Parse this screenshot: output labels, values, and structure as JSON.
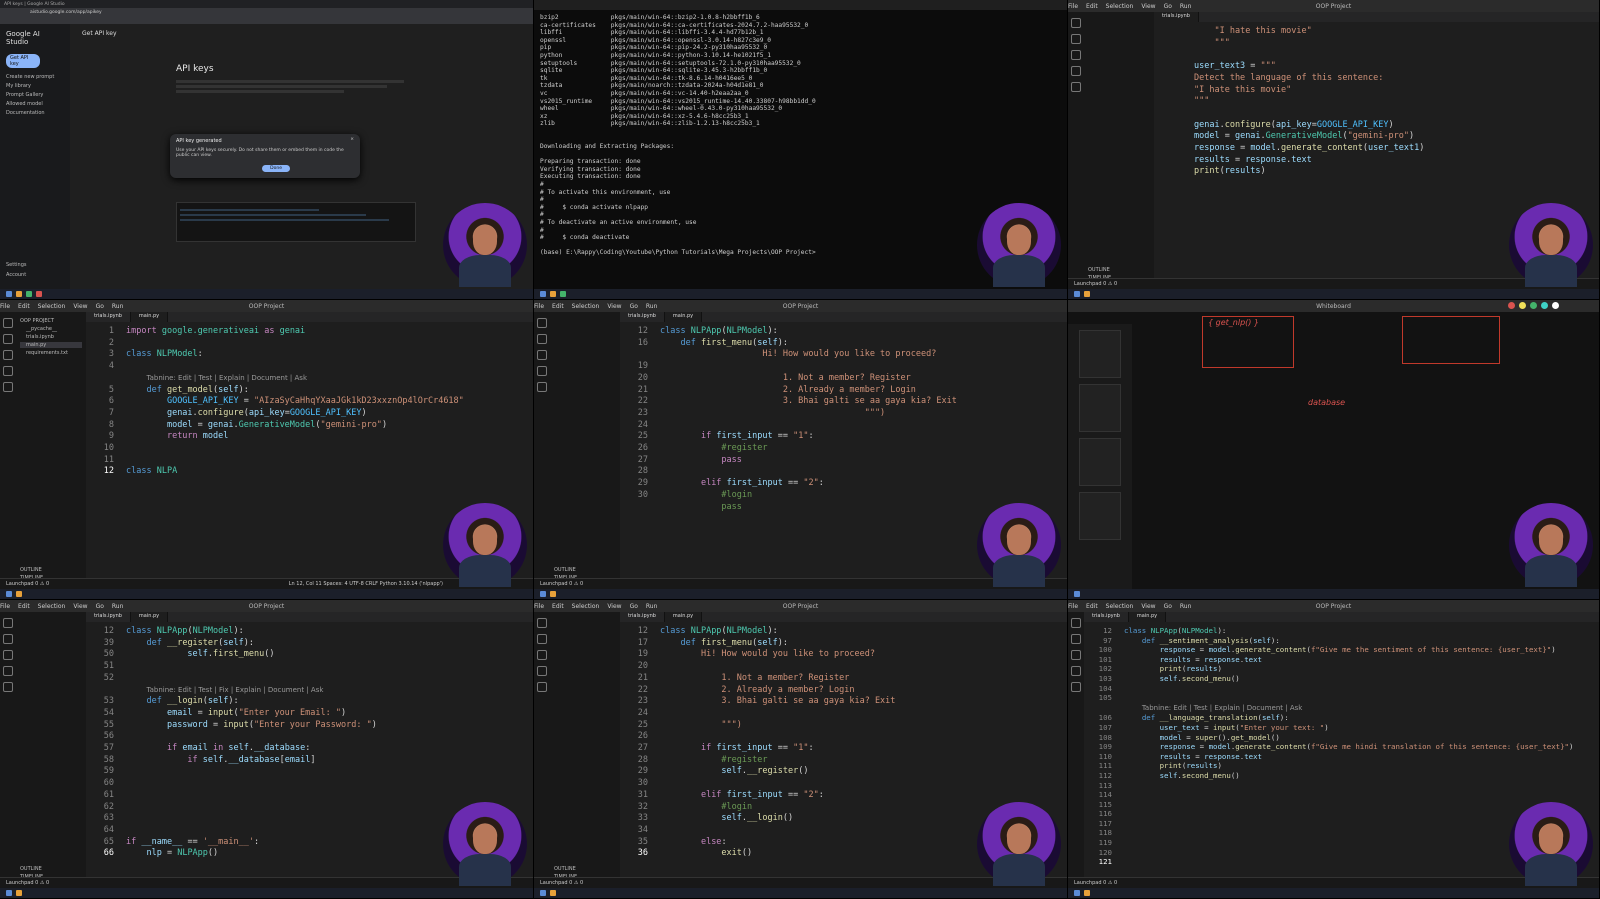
{
  "panel1": {
    "browser": {
      "tab_title": "API keys | Google AI Studio",
      "address": "aistudio.google.com/app/apikey"
    },
    "ai_studio": {
      "brand": "Google AI Studio",
      "header": "Get API key",
      "get_api_key_button": "Get API key",
      "nav_items": [
        "Create new prompt",
        "My library",
        "Prompt Gallery",
        "Allowed model",
        "Documentation"
      ],
      "footer_items": [
        "Settings",
        "Account"
      ],
      "page_title": "API keys",
      "dialog_title": "API key generated",
      "dialog_text": "Use your API keys securely. Do not share them or embed them in code the public can view.",
      "dialog_done": "Done"
    }
  },
  "panel2": {
    "terminal_lines": [
      "bzip2              pkgs/main/win-64::bzip2-1.0.8-h2bbff1b_6",
      "ca-certificates    pkgs/main/win-64::ca-certificates-2024.7.2-haa95532_0",
      "libffi             pkgs/main/win-64::libffi-3.4.4-hd77b12b_1",
      "openssl            pkgs/main/win-64::openssl-3.0.14-h827c3e9_0",
      "pip                pkgs/main/win-64::pip-24.2-py310haa95532_0",
      "python             pkgs/main/win-64::python-3.10.14-he1021f5_1",
      "setuptools         pkgs/main/win-64::setuptools-72.1.0-py310haa95532_0",
      "sqlite             pkgs/main/win-64::sqlite-3.45.3-h2bbff1b_0",
      "tk                 pkgs/main/win-64::tk-8.6.14-h0416ee5_0",
      "tzdata             pkgs/main/noarch::tzdata-2024a-h04d1e81_0",
      "vc                 pkgs/main/win-64::vc-14.40-h2eaa2aa_0",
      "vs2015_runtime     pkgs/main/win-64::vs2015_runtime-14.40.33807-h98bb1dd_0",
      "wheel              pkgs/main/win-64::wheel-0.43.0-py310haa95532_0",
      "xz                 pkgs/main/win-64::xz-5.4.6-h8cc25b3_1",
      "zlib               pkgs/main/win-64::zlib-1.2.13-h8cc25b3_1",
      "",
      "",
      "Downloading and Extracting Packages:",
      "",
      "Preparing transaction: done",
      "Verifying transaction: done",
      "Executing transaction: done",
      "#",
      "# To activate this environment, use",
      "#",
      "#     $ conda activate nlpapp",
      "#",
      "# To deactivate an active environment, use",
      "#",
      "#     $ conda deactivate",
      "",
      "(base) E:\\Rappy\\Coding\\Youtube\\Python Tutorials\\Mega Projects\\OOP Project>"
    ]
  },
  "panel3": {
    "title": "OOP Project",
    "tabs": [
      "trials.ipynb"
    ],
    "code_lines": [
      {
        "n": "",
        "html": "    <span class='str'>\"I hate this movie\"</span>"
      },
      {
        "n": "",
        "html": "    <span class='str'>\"\"\"</span>"
      },
      {
        "n": "",
        "html": ""
      },
      {
        "n": "",
        "html": "<span class='var'>user_text3</span> = <span class='str'>\"\"\"</span>"
      },
      {
        "n": "",
        "html": "<span class='str'>Detect the language of this sentence:</span>"
      },
      {
        "n": "",
        "html": "<span class='str'>\"I hate this movie\"</span>"
      },
      {
        "n": "",
        "html": "<span class='str'>\"\"\"</span>"
      },
      {
        "n": "",
        "html": ""
      },
      {
        "n": "",
        "html": "<span class='var'>genai</span>.<span class='fn'>configure</span>(<span class='var'>api_key</span>=<span class='const'>GOOGLE_API_KEY</span>)"
      },
      {
        "n": "",
        "html": "<span class='var'>model</span> = <span class='var'>genai</span>.<span class='cls'>GenerativeModel</span>(<span class='str'>\"gemini-pro\"</span>)"
      },
      {
        "n": "",
        "html": "<span class='var'>response</span> = <span class='var'>model</span>.<span class='fn'>generate_content</span>(<span class='var'>user_text1</span>)"
      },
      {
        "n": "",
        "html": "<span class='var'>results</span> = <span class='var'>response</span>.<span class='var'>text</span>"
      },
      {
        "n": "",
        "html": "<span class='fn'>print</span>(<span class='var'>results</span>)"
      }
    ]
  },
  "panel4": {
    "title": "OOP Project",
    "tabs": [
      "trials.ipynb",
      "main.py"
    ],
    "explorer": [
      "OOP PROJECT",
      "__pycache__",
      "trials.ipynb",
      "main.py",
      "requirements.txt"
    ],
    "code_lines": [
      {
        "n": "1",
        "html": "<span class='kw'>import</span> <span class='cls'>google.generativeai</span> <span class='kw'>as</span> <span class='cls'>genai</span>"
      },
      {
        "n": "2",
        "html": ""
      },
      {
        "n": "3",
        "html": "<span class='kwb'>class</span> <span class='cls'>NLPModel</span>:"
      },
      {
        "n": "4",
        "html": ""
      },
      {
        "n": "",
        "html": "    <span class='hint'>Tabnine: Edit | Test | Explain | Document | Ask</span>"
      },
      {
        "n": "5",
        "html": "    <span class='kwb'>def</span> <span class='fn'>get_model</span>(<span class='var'>self</span>):"
      },
      {
        "n": "6",
        "html": "        <span class='const'>GOOGLE_API_KEY</span> = <span class='str'>\"AIzaSyCaHhqYXaaJGk1kD23xxznOp4lOrCr4618\"</span>"
      },
      {
        "n": "7",
        "html": "        <span class='var'>genai</span>.<span class='fn'>configure</span>(<span class='var'>api_key</span>=<span class='const'>GOOGLE_API_KEY</span>)"
      },
      {
        "n": "8",
        "html": "        <span class='var'>model</span> = <span class='var'>genai</span>.<span class='cls'>GenerativeModel</span>(<span class='str'>\"gemini-pro\"</span>)"
      },
      {
        "n": "9",
        "html": "        <span class='kw'>return</span> <span class='var'>model</span>"
      },
      {
        "n": "10",
        "html": ""
      },
      {
        "n": "11",
        "html": ""
      },
      {
        "n": "12",
        "html": "<span class='kwb'>class</span> <span class='cls'>NLPA</span>"
      }
    ],
    "status": "Ln 12, Col 11   Spaces: 4   UTF-8   CRLF   Python   3.10.14 ('nlpapp')"
  },
  "panel5": {
    "title": "OOP Project",
    "tabs": [
      "trials.ipynb",
      "main.py"
    ],
    "code_lines": [
      {
        "n": "12",
        "html": "<span class='kwb'>class</span> <span class='cls'>NLPApp</span>(<span class='cls'>NLPModel</span>):"
      },
      {
        "n": "16",
        "html": "    <span class='kwb'>def</span> <span class='fn'>first_menu</span>(<span class='var'>self</span>):"
      },
      {
        "n": "",
        "html": "                    <span class='str'>Hi! How would you like to proceed?</span>"
      },
      {
        "n": "19",
        "html": ""
      },
      {
        "n": "20",
        "html": "                        <span class='str'>1. Not a member? Register</span>"
      },
      {
        "n": "21",
        "html": "                        <span class='str'>2. Already a member? Login</span>"
      },
      {
        "n": "22",
        "html": "                        <span class='str'>3. Bhai galti se aa gaya kia? Exit</span>"
      },
      {
        "n": "23",
        "html": "                                        <span class='str'>\"\"\")</span>"
      },
      {
        "n": "24",
        "html": ""
      },
      {
        "n": "25",
        "html": "        <span class='kw'>if</span> <span class='var'>first_input</span> == <span class='str'>\"1\"</span>:"
      },
      {
        "n": "26",
        "html": "            <span class='cm'>#register</span>"
      },
      {
        "n": "27",
        "html": "            <span class='kw'>pass</span>"
      },
      {
        "n": "28",
        "html": ""
      },
      {
        "n": "29",
        "html": "        <span class='kw'>elif</span> <span class='var'>first_input</span> == <span class='str'>\"2\"</span>:"
      },
      {
        "n": "30",
        "html": "            <span class='cm'>#login</span>"
      },
      {
        "n": "",
        "html": "            <span class='cm'>pass</span>"
      }
    ]
  },
  "panel6": {
    "toolbar_title": "Whiteboard",
    "annotations": [
      "{ get_nlp() }",
      "database"
    ]
  },
  "panel7": {
    "title": "OOP Project",
    "tabs": [
      "trials.ipynb",
      "main.py"
    ],
    "code_lines": [
      {
        "n": "12",
        "html": "<span class='kwb'>class</span> <span class='cls'>NLPApp</span>(<span class='cls'>NLPModel</span>):"
      },
      {
        "n": "39",
        "html": "    <span class='kwb'>def</span> <span class='fn'>__register</span>(<span class='var'>self</span>):"
      },
      {
        "n": "50",
        "html": "            <span class='var'>self</span>.<span class='fn'>first_menu</span>()"
      },
      {
        "n": "51",
        "html": ""
      },
      {
        "n": "52",
        "html": ""
      },
      {
        "n": "",
        "html": "    <span class='hint'>Tabnine: Edit | Test | Fix | Explain | Document | Ask</span>"
      },
      {
        "n": "53",
        "html": "    <span class='kwb'>def</span> <span class='fn'>__login</span>(<span class='var'>self</span>):"
      },
      {
        "n": "54",
        "html": "        <span class='var'>email</span> = <span class='fn'>input</span>(<span class='str'>\"Enter your Email: \"</span>)"
      },
      {
        "n": "55",
        "html": "        <span class='var'>password</span> = <span class='fn'>input</span>(<span class='str'>\"Enter your Password: \"</span>)"
      },
      {
        "n": "56",
        "html": ""
      },
      {
        "n": "57",
        "html": "        <span class='kw'>if</span> <span class='var'>email</span> <span class='kw'>in</span> <span class='var'>self</span>.<span class='var'>__database</span>:"
      },
      {
        "n": "58",
        "html": "            <span class='kw'>if</span> <span class='var'>self</span>.<span class='var'>__database</span>[<span class='var'>email</span>]"
      },
      {
        "n": "59",
        "html": ""
      },
      {
        "n": "60",
        "html": ""
      },
      {
        "n": "61",
        "html": ""
      },
      {
        "n": "62",
        "html": ""
      },
      {
        "n": "63",
        "html": ""
      },
      {
        "n": "64",
        "html": ""
      },
      {
        "n": "65",
        "html": "<span class='kw'>if</span> <span class='var'>__name__</span> == <span class='str'>'__main__'</span>:"
      },
      {
        "n": "66",
        "html": "    <span class='var'>nlp</span> = <span class='cls'>NLPApp</span>()"
      }
    ]
  },
  "panel8": {
    "title": "OOP Project",
    "tabs": [
      "trials.ipynb",
      "main.py"
    ],
    "code_lines": [
      {
        "n": "12",
        "html": "<span class='kwb'>class</span> <span class='cls'>NLPApp</span>(<span class='cls'>NLPModel</span>):"
      },
      {
        "n": "17",
        "html": "    <span class='kwb'>def</span> <span class='fn'>first_menu</span>(<span class='var'>self</span>):"
      },
      {
        "n": "19",
        "html": "        <span class='str'>Hi! How would you like to proceed?</span>"
      },
      {
        "n": "20",
        "html": ""
      },
      {
        "n": "21",
        "html": "            <span class='str'>1. Not a member? Register</span>"
      },
      {
        "n": "22",
        "html": "            <span class='str'>2. Already a member? Login</span>"
      },
      {
        "n": "23",
        "html": "            <span class='str'>3. Bhai galti se aa gaya kia? Exit</span>"
      },
      {
        "n": "24",
        "html": ""
      },
      {
        "n": "25",
        "html": "            <span class='str'>\"\"\")</span>"
      },
      {
        "n": "26",
        "html": ""
      },
      {
        "n": "27",
        "html": "        <span class='kw'>if</span> <span class='var'>first_input</span> == <span class='str'>\"1\"</span>:"
      },
      {
        "n": "28",
        "html": "            <span class='cm'>#register</span>"
      },
      {
        "n": "29",
        "html": "            <span class='var'>self</span>.<span class='fn'>__register</span>()"
      },
      {
        "n": "30",
        "html": ""
      },
      {
        "n": "31",
        "html": "        <span class='kw'>elif</span> <span class='var'>first_input</span> == <span class='str'>\"2\"</span>:"
      },
      {
        "n": "32",
        "html": "            <span class='cm'>#login</span>"
      },
      {
        "n": "33",
        "html": "            <span class='var'>self</span>.<span class='fn'>__login</span>()"
      },
      {
        "n": "34",
        "html": ""
      },
      {
        "n": "35",
        "html": "        <span class='kw'>else</span>:"
      },
      {
        "n": "36",
        "html": "            <span class='fn'>exit</span>()"
      }
    ]
  },
  "panel9": {
    "title": "OOP Project",
    "tabs": [
      "trials.ipynb",
      "main.py"
    ],
    "code_lines": [
      {
        "n": "12",
        "html": "<span class='kwb'>class</span> <span class='cls'>NLPApp</span>(<span class='cls'>NLPModel</span>):"
      },
      {
        "n": "97",
        "html": "    <span class='kwb'>def</span> <span class='fn'>__sentiment_analysis</span>(<span class='var'>self</span>):"
      },
      {
        "n": "100",
        "html": "        <span class='var'>response</span> = <span class='var'>model</span>.<span class='fn'>generate_content</span>(<span class='str'>f\"Give me the sentiment of this sentence: {user_text}\"</span>)"
      },
      {
        "n": "101",
        "html": "        <span class='var'>results</span> = <span class='var'>response</span>.<span class='var'>text</span>"
      },
      {
        "n": "102",
        "html": "        <span class='fn'>print</span>(<span class='var'>results</span>)"
      },
      {
        "n": "103",
        "html": "        <span class='var'>self</span>.<span class='fn'>second_menu</span>()"
      },
      {
        "n": "104",
        "html": ""
      },
      {
        "n": "105",
        "html": ""
      },
      {
        "n": "",
        "html": "    <span class='hint'>Tabnine: Edit | Test | Explain | Document | Ask</span>"
      },
      {
        "n": "106",
        "html": "    <span class='kwb'>def</span> <span class='fn'>__language_translation</span>(<span class='var'>self</span>):"
      },
      {
        "n": "107",
        "html": "        <span class='var'>user_text</span> = <span class='fn'>input</span>(<span class='str'>\"Enter your text: \"</span>)"
      },
      {
        "n": "108",
        "html": "        <span class='var'>model</span> = <span class='fn'>super</span>().<span class='fn'>get_model</span>()"
      },
      {
        "n": "109",
        "html": "        <span class='var'>response</span> = <span class='var'>model</span>.<span class='fn'>generate_content</span>(<span class='str'>f\"Give me hindi translation of this sentence: {user_text}\"</span>)"
      },
      {
        "n": "110",
        "html": "        <span class='var'>results</span> = <span class='var'>response</span>.<span class='var'>text</span>"
      },
      {
        "n": "111",
        "html": "        <span class='fn'>print</span>(<span class='var'>results</span>)"
      },
      {
        "n": "112",
        "html": "        <span class='var'>self</span>.<span class='fn'>second_menu</span>()"
      },
      {
        "n": "113",
        "html": ""
      },
      {
        "n": "114",
        "html": ""
      },
      {
        "n": "115",
        "html": ""
      },
      {
        "n": "116",
        "html": ""
      },
      {
        "n": "117",
        "html": ""
      },
      {
        "n": "118",
        "html": ""
      },
      {
        "n": "119",
        "html": ""
      },
      {
        "n": "120",
        "html": ""
      },
      {
        "n": "121",
        "html": ""
      }
    ]
  },
  "common": {
    "menu": [
      "File",
      "Edit",
      "Selection",
      "View",
      "Go",
      "Run"
    ],
    "outline_label": "OUTLINE",
    "timeline_label": "TIMELINE",
    "statusbar_left": "Launchpad   0 ⚠ 0"
  }
}
